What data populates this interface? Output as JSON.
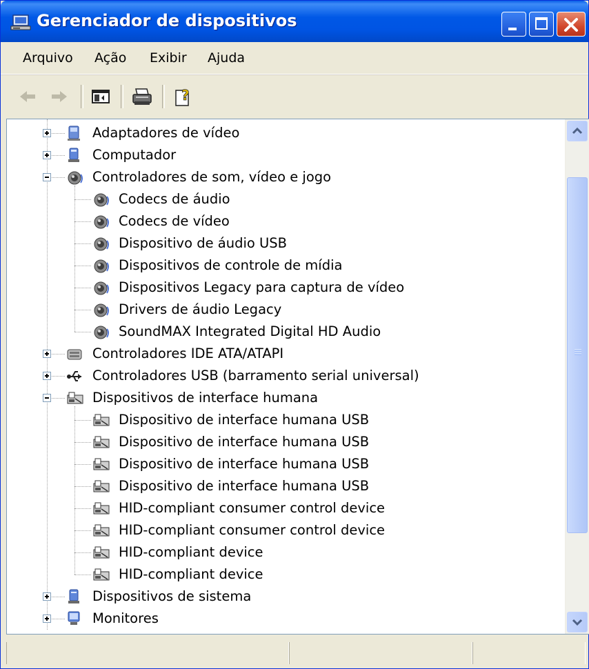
{
  "window": {
    "title": "Gerenciador de dispositivos",
    "title_icon": "device-manager-icon"
  },
  "menubar": {
    "items": [
      "Arquivo",
      "Ação",
      "Exibir",
      "Ajuda"
    ]
  },
  "toolbar": {
    "buttons": [
      "back-arrow-icon",
      "forward-arrow-icon",
      "show-hide-console-tree-icon",
      "print-icon",
      "help-icon"
    ]
  },
  "tree": {
    "items": [
      {
        "label": "Adaptadores de vídeo",
        "icon": "display-adapter-icon",
        "level": 0,
        "expander": "+"
      },
      {
        "label": "Computador",
        "icon": "computer-icon",
        "level": 0,
        "expander": "+"
      },
      {
        "label": "Controladores de som, vídeo e jogo",
        "icon": "speaker-icon",
        "level": 0,
        "expander": "-"
      },
      {
        "label": "Codecs de áudio",
        "icon": "speaker-icon",
        "level": 1
      },
      {
        "label": "Codecs de vídeo",
        "icon": "speaker-icon",
        "level": 1
      },
      {
        "label": "Dispositivo de áudio USB",
        "icon": "speaker-icon",
        "level": 1
      },
      {
        "label": "Dispositivos de controle de mídia",
        "icon": "speaker-icon",
        "level": 1
      },
      {
        "label": "Dispositivos Legacy para captura de vídeo",
        "icon": "speaker-icon",
        "level": 1
      },
      {
        "label": "Drivers de áudio Legacy",
        "icon": "speaker-icon",
        "level": 1
      },
      {
        "label": "SoundMAX Integrated Digital HD Audio",
        "icon": "speaker-icon",
        "level": 1
      },
      {
        "label": "Controladores IDE ATA/ATAPI",
        "icon": "ide-controller-icon",
        "level": 0,
        "expander": "+"
      },
      {
        "label": "Controladores USB (barramento serial universal)",
        "icon": "usb-icon",
        "level": 0,
        "expander": "+"
      },
      {
        "label": "Dispositivos de interface humana",
        "icon": "hid-icon",
        "level": 0,
        "expander": "-"
      },
      {
        "label": "Dispositivo de interface humana USB",
        "icon": "hid-icon",
        "level": 1
      },
      {
        "label": "Dispositivo de interface humana USB",
        "icon": "hid-icon",
        "level": 1
      },
      {
        "label": "Dispositivo de interface humana USB",
        "icon": "hid-icon",
        "level": 1
      },
      {
        "label": "Dispositivo de interface humana USB",
        "icon": "hid-icon",
        "level": 1
      },
      {
        "label": "HID-compliant consumer control device",
        "icon": "hid-icon",
        "level": 1
      },
      {
        "label": "HID-compliant consumer control device",
        "icon": "hid-icon",
        "level": 1
      },
      {
        "label": "HID-compliant device",
        "icon": "hid-icon",
        "level": 1
      },
      {
        "label": "HID-compliant device",
        "icon": "hid-icon",
        "level": 1
      },
      {
        "label": "Dispositivos de sistema",
        "icon": "system-device-icon",
        "level": 0,
        "expander": "+"
      },
      {
        "label": "Monitores",
        "icon": "monitor-icon",
        "level": 0,
        "expander": "+"
      }
    ]
  },
  "colors": {
    "titlebar": "#0054E3",
    "chrome": "#ECE9D8",
    "scroll_thumb": "#C1D3FB"
  }
}
